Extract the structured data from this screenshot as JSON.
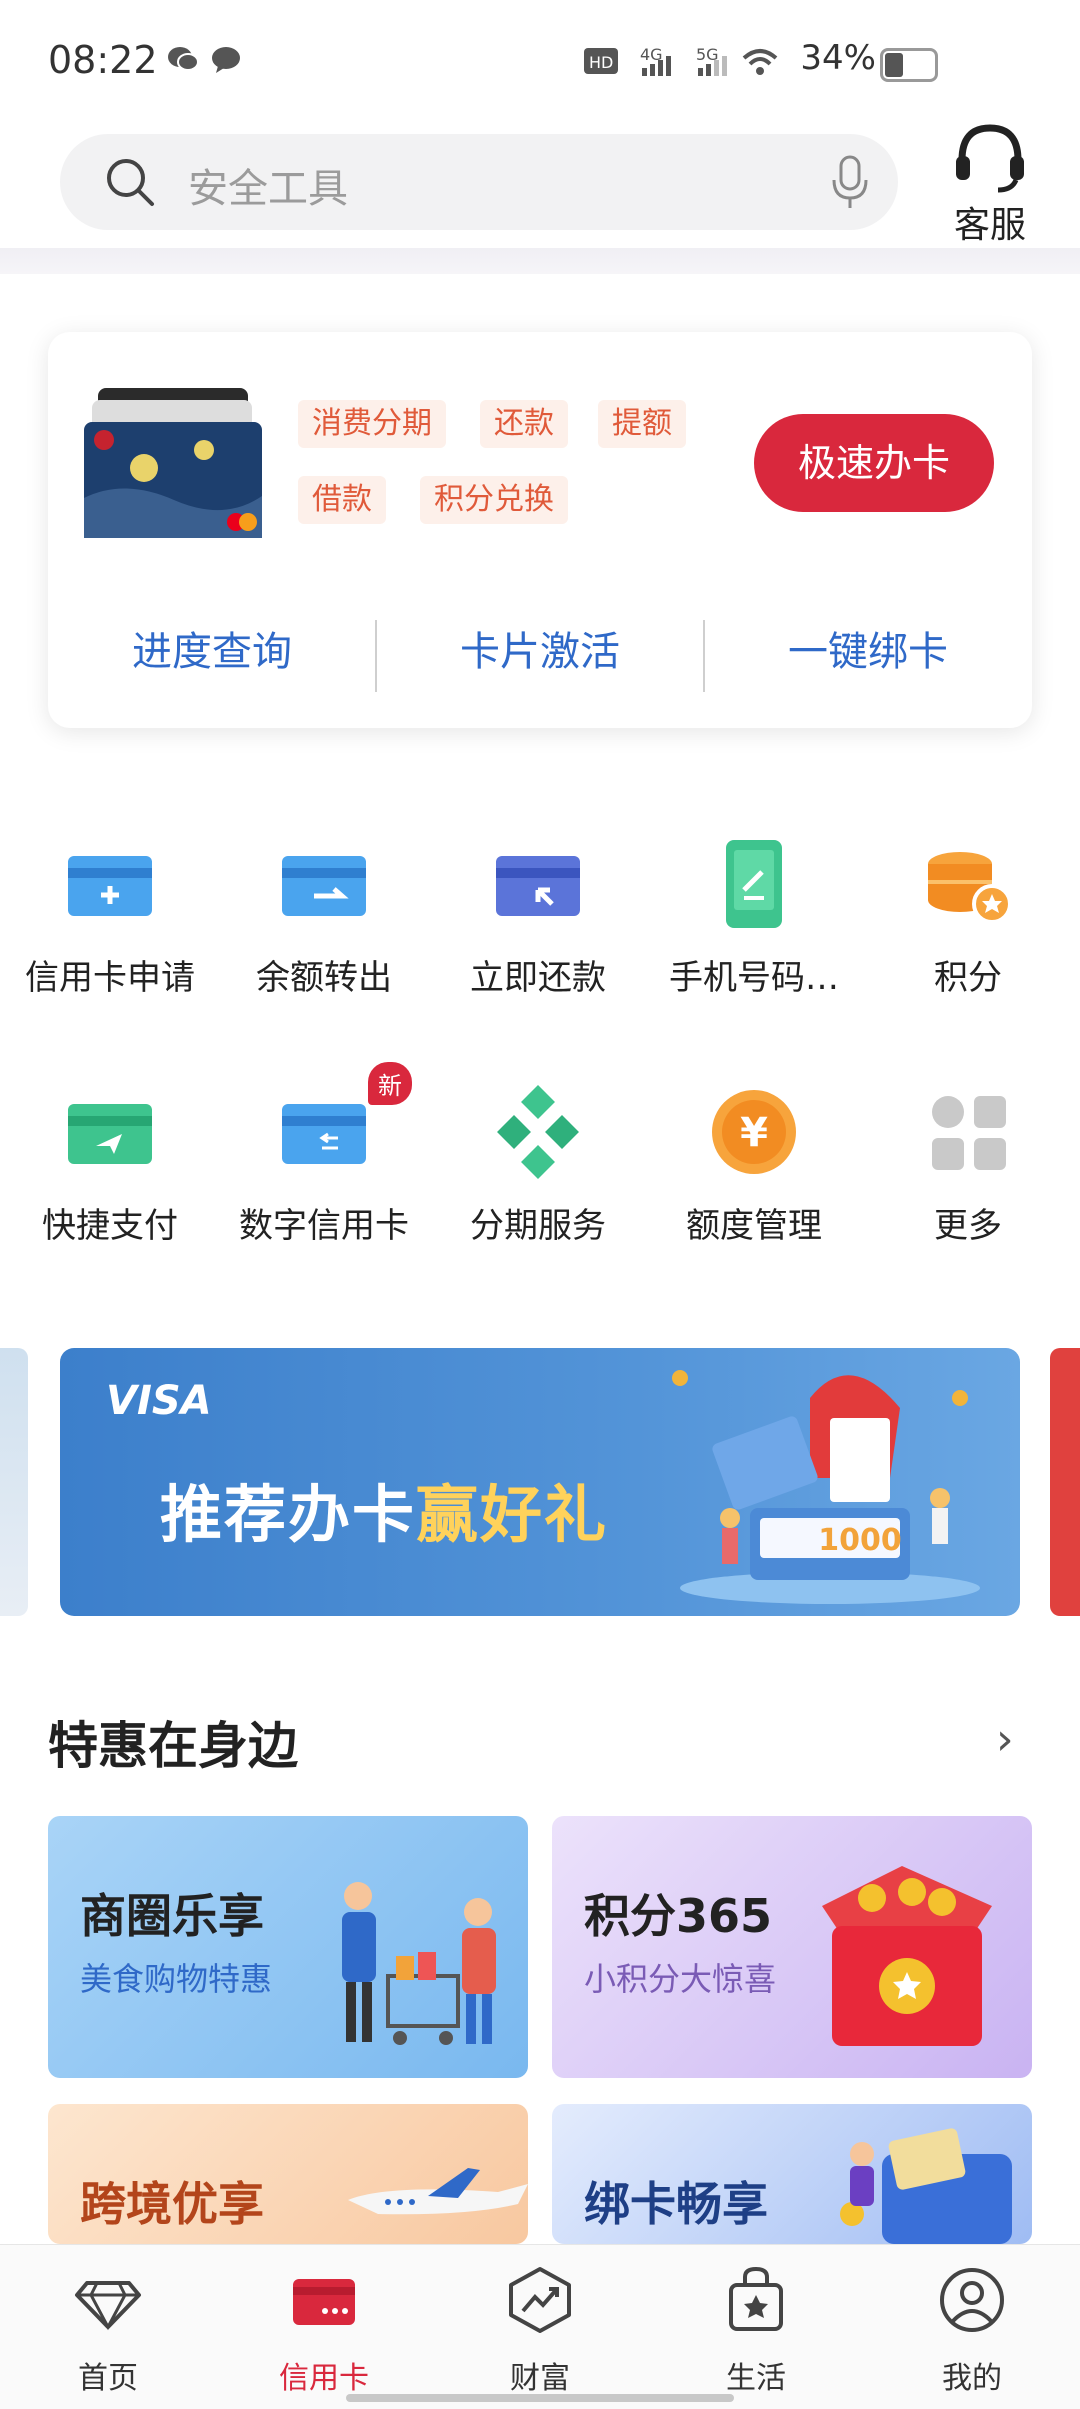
{
  "status_bar": {
    "time": "08:22",
    "network": "HD 4G 5G",
    "battery": "34%"
  },
  "search": {
    "placeholder": "安全工具"
  },
  "service": {
    "label": "客服"
  },
  "card_section": {
    "tags": [
      "消费分期",
      "还款",
      "提额",
      "借款",
      "积分兑换"
    ],
    "apply_button": "极速办卡",
    "links": [
      "进度查询",
      "卡片激活",
      "一键绑卡"
    ]
  },
  "grid": [
    {
      "label": "信用卡申请",
      "icon": "card-add-icon"
    },
    {
      "label": "余额转出",
      "icon": "card-transfer-icon"
    },
    {
      "label": "立即还款",
      "icon": "card-repay-icon"
    },
    {
      "label": "手机号码…",
      "icon": "phone-icon"
    },
    {
      "label": "积分",
      "icon": "points-icon"
    },
    {
      "label": "快捷支付",
      "icon": "quick-pay-icon"
    },
    {
      "label": "数字信用卡",
      "icon": "digital-card-icon",
      "badge": "新"
    },
    {
      "label": "分期服务",
      "icon": "installment-icon"
    },
    {
      "label": "额度管理",
      "icon": "limit-icon"
    },
    {
      "label": "更多",
      "icon": "more-grid-icon"
    }
  ],
  "banner": {
    "brand": "VISA",
    "title_main": "推荐办卡",
    "title_highlight": "赢好礼",
    "amount": "1000"
  },
  "section": {
    "title": "特惠在身边",
    "more": "›"
  },
  "tiles": [
    {
      "title": "商圈乐享",
      "subtitle": "美食购物特惠"
    },
    {
      "title": "积分365",
      "subtitle": "小积分大惊喜"
    },
    {
      "title": "跨境优享",
      "subtitle": ""
    },
    {
      "title": "绑卡畅享",
      "subtitle": ""
    }
  ],
  "bottom_nav": [
    {
      "label": "首页",
      "icon": "diamond-icon"
    },
    {
      "label": "信用卡",
      "icon": "credit-card-icon",
      "active": true
    },
    {
      "label": "财富",
      "icon": "wealth-icon"
    },
    {
      "label": "生活",
      "icon": "life-bag-icon"
    },
    {
      "label": "我的",
      "icon": "profile-icon"
    }
  ],
  "colors": {
    "accent": "#d9283d",
    "link": "#2f69c8",
    "tag": "#e05a3a"
  }
}
